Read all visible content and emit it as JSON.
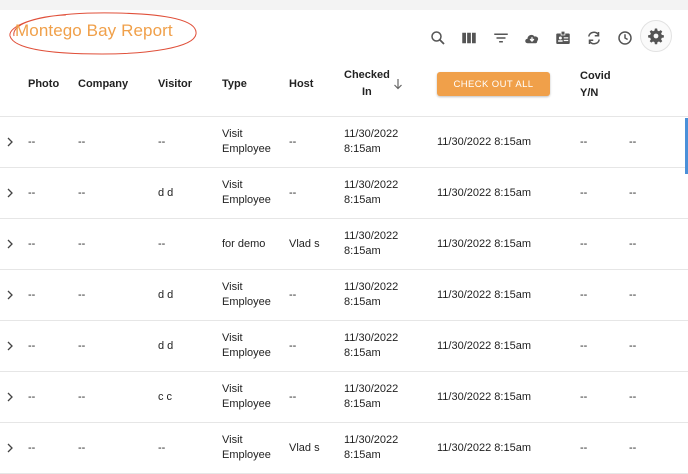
{
  "header": {
    "title": "Montego Bay Report"
  },
  "toolbar": {
    "icons": [
      "search-icon",
      "columns-icon",
      "filter-icon",
      "cloud-download-icon",
      "badge-icon",
      "refresh-icon",
      "clock-icon",
      "gear-icon"
    ]
  },
  "columns": {
    "photo": "Photo",
    "company": "Company",
    "visitor": "Visitor",
    "type": "Type",
    "host": "Host",
    "checked_in_1": "Checked",
    "checked_in_2": "In",
    "checkout_button": "CHECK OUT ALL",
    "covid_1": "Covid",
    "covid_2": "Y/N"
  },
  "rows": [
    {
      "photo": "--",
      "company": "--",
      "visitor": "--",
      "type_1": "Visit",
      "type_2": "Employee",
      "host": "--",
      "checked_1": "11/30/2022",
      "checked_2": "8:15am",
      "checkout": "11/30/2022 8:15am",
      "covid": "--",
      "extra": "--"
    },
    {
      "photo": "--",
      "company": "--",
      "visitor": "d d",
      "type_1": "Visit",
      "type_2": "Employee",
      "host": "--",
      "checked_1": "11/30/2022",
      "checked_2": "8:15am",
      "checkout": "11/30/2022 8:15am",
      "covid": "--",
      "extra": "--"
    },
    {
      "photo": "--",
      "company": "--",
      "visitor": "--",
      "type_1": "for demo",
      "type_2": "",
      "host": "Vlad s",
      "checked_1": "11/30/2022",
      "checked_2": "8:15am",
      "checkout": "11/30/2022 8:15am",
      "covid": "--",
      "extra": "--"
    },
    {
      "photo": "--",
      "company": "--",
      "visitor": "d d",
      "type_1": "Visit",
      "type_2": "Employee",
      "host": "--",
      "checked_1": "11/30/2022",
      "checked_2": "8:15am",
      "checkout": "11/30/2022 8:15am",
      "covid": "--",
      "extra": "--"
    },
    {
      "photo": "--",
      "company": "--",
      "visitor": "d d",
      "type_1": "Visit",
      "type_2": "Employee",
      "host": "--",
      "checked_1": "11/30/2022",
      "checked_2": "8:15am",
      "checkout": "11/30/2022 8:15am",
      "covid": "--",
      "extra": "--"
    },
    {
      "photo": "--",
      "company": "--",
      "visitor": "c c",
      "type_1": "Visit",
      "type_2": "Employee",
      "host": "--",
      "checked_1": "11/30/2022",
      "checked_2": "8:15am",
      "checkout": "11/30/2022 8:15am",
      "covid": "--",
      "extra": "--"
    },
    {
      "photo": "--",
      "company": "--",
      "visitor": "--",
      "type_1": "Visit",
      "type_2": "Employee",
      "host": "Vlad s",
      "checked_1": "11/30/2022",
      "checked_2": "8:15am",
      "checkout": "11/30/2022 8:15am",
      "covid": "--",
      "extra": "--"
    }
  ],
  "colors": {
    "accent": "#f0a04a",
    "annotation": "#e0503a",
    "row_divider": "#e6e6e6"
  }
}
